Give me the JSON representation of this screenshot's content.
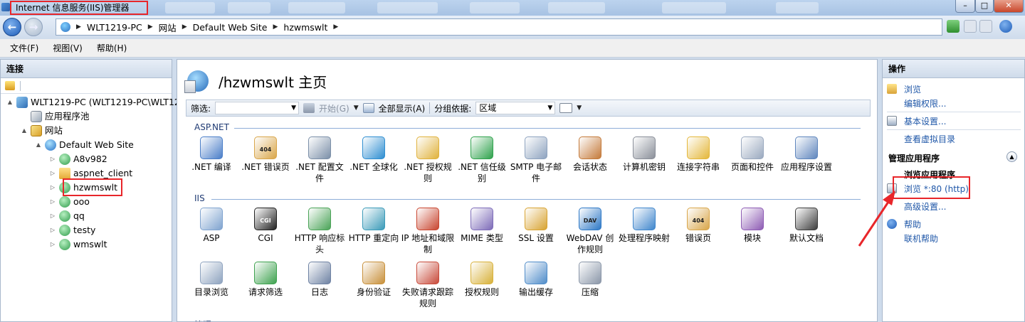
{
  "window": {
    "title": "Internet 信息服务(IIS)管理器",
    "minimize": "–",
    "maximize": "□",
    "close": "✕"
  },
  "nav": {
    "breadcrumb": [
      "WLT1219-PC",
      "网站",
      "Default Web Site",
      "hzwmswlt"
    ],
    "back_icon": "back-arrow-icon",
    "forward_icon": "forward-arrow-icon",
    "back_glyph": "←",
    "forward_glyph": "→",
    "sep_glyph": "▶"
  },
  "menu": [
    "文件(F)",
    "视图(V)",
    "帮助(H)"
  ],
  "connections": {
    "header": "连接",
    "tree": [
      {
        "label": "WLT1219-PC (WLT1219-PC\\WLT12",
        "level": 0,
        "icon": "server-icon",
        "toggle": "▲"
      },
      {
        "label": "应用程序池",
        "level": 1,
        "icon": "app-pool-icon",
        "toggle": ""
      },
      {
        "label": "网站",
        "level": 1,
        "icon": "sites-folder-icon",
        "toggle": "▲"
      },
      {
        "label": "Default Web Site",
        "level": 2,
        "icon": "website-icon",
        "toggle": "▲"
      },
      {
        "label": "A8v982",
        "level": 3,
        "icon": "application-icon",
        "toggle": "▷"
      },
      {
        "label": "aspnet_client",
        "level": 3,
        "icon": "folder-icon",
        "toggle": "▷"
      },
      {
        "label": "hzwmswlt",
        "level": 3,
        "icon": "application-icon",
        "toggle": "▷"
      },
      {
        "label": "ooo",
        "level": 3,
        "icon": "application-icon",
        "toggle": "▷"
      },
      {
        "label": "qq",
        "level": 3,
        "icon": "application-icon",
        "toggle": "▷"
      },
      {
        "label": "testy",
        "level": 3,
        "icon": "application-icon",
        "toggle": "▷"
      },
      {
        "label": "wmswlt",
        "level": 3,
        "icon": "application-icon",
        "toggle": "▷"
      }
    ]
  },
  "main": {
    "title": "/hzwmswlt 主页",
    "filter_label": "筛选:",
    "start_label": "开始(G)",
    "show_all_label": "全部显示(A)",
    "group_by_label": "分组依据:",
    "group_by_value": "区域",
    "dropdown_glyph": "▼",
    "groups": [
      {
        "name": "ASP.NET",
        "features": [
          {
            "label": ".NET 编译",
            "icon": "net-compilation-icon",
            "color": "#4a7ec8"
          },
          {
            "label": ".NET 错误页",
            "icon": "net-error-pages-icon",
            "color": "#d9a64a",
            "badge": "404"
          },
          {
            "label": ".NET 配置文件",
            "icon": "net-profile-icon",
            "color": "#7b8fa8"
          },
          {
            "label": ".NET 全球化",
            "icon": "net-globalization-icon",
            "color": "#2e8ed1"
          },
          {
            "label": ".NET 授权规则",
            "icon": "net-authorization-icon",
            "color": "#e0b23c"
          },
          {
            "label": ".NET 信任级别",
            "icon": "net-trust-icon",
            "color": "#2fa24c"
          },
          {
            "label": "SMTP 电子邮件",
            "icon": "smtp-email-icon",
            "color": "#8ea3bf"
          },
          {
            "label": "会话状态",
            "icon": "session-state-icon",
            "color": "#c47a3a"
          },
          {
            "label": "计算机密钥",
            "icon": "machine-key-icon",
            "color": "#8a8f99"
          },
          {
            "label": "连接字符串",
            "icon": "connection-strings-icon",
            "color": "#e4b73a"
          },
          {
            "label": "页面和控件",
            "icon": "pages-controls-icon",
            "color": "#9aa9bf"
          },
          {
            "label": "应用程序设置",
            "icon": "app-settings-icon",
            "color": "#5f86bd"
          }
        ]
      },
      {
        "name": "IIS",
        "features": [
          {
            "label": "ASP",
            "icon": "asp-icon",
            "color": "#7fa3cf"
          },
          {
            "label": "CGI",
            "icon": "cgi-icon",
            "color": "#222222",
            "badge": "CGI"
          },
          {
            "label": "HTTP 响应标头",
            "icon": "http-headers-icon",
            "color": "#4aa357"
          },
          {
            "label": "HTTP 重定向",
            "icon": "http-redirect-icon",
            "color": "#3a9ab8"
          },
          {
            "label": "IP 地址和域限制",
            "icon": "ip-restrictions-icon",
            "color": "#c8452f"
          },
          {
            "label": "MIME 类型",
            "icon": "mime-types-icon",
            "color": "#7d6bb8"
          },
          {
            "label": "SSL 设置",
            "icon": "ssl-settings-icon",
            "color": "#d8a331"
          },
          {
            "label": "WebDAV 创作规则",
            "icon": "webdav-icon",
            "color": "#2d78c6",
            "badge": "DAV"
          },
          {
            "label": "处理程序映射",
            "icon": "handler-mappings-icon",
            "color": "#3f86cc"
          },
          {
            "label": "错误页",
            "icon": "error-pages-icon",
            "color": "#d9a64a",
            "badge": "404"
          },
          {
            "label": "模块",
            "icon": "modules-icon",
            "color": "#8d5bb3"
          },
          {
            "label": "默认文档",
            "icon": "default-document-icon",
            "color": "#3d3d3d"
          }
        ]
      },
      {
        "name": "",
        "features": [
          {
            "label": "目录浏览",
            "icon": "directory-browsing-icon",
            "color": "#8ea3bf"
          },
          {
            "label": "请求筛选",
            "icon": "request-filtering-icon",
            "color": "#3ea24f"
          },
          {
            "label": "日志",
            "icon": "logging-icon",
            "color": "#6e82a3"
          },
          {
            "label": "身份验证",
            "icon": "authentication-icon",
            "color": "#c8903a"
          },
          {
            "label": "失败请求跟踪规则",
            "icon": "failed-request-tracing-icon",
            "color": "#c84a3a"
          },
          {
            "label": "授权规则",
            "icon": "authorization-rules-icon",
            "color": "#d8b13a"
          },
          {
            "label": "输出缓存",
            "icon": "output-caching-icon",
            "color": "#4f8cc9"
          },
          {
            "label": "压缩",
            "icon": "compression-icon",
            "color": "#8a96a8"
          }
        ]
      }
    ],
    "cut_group": "管理"
  },
  "actions": {
    "header": "操作",
    "items": [
      {
        "label": "浏览",
        "icon": "explore-icon"
      },
      {
        "label": "编辑权限...",
        "icon": ""
      },
      {
        "label": "基本设置...",
        "icon": "basic-settings-icon"
      },
      {
        "label": "查看虚拟目录",
        "icon": ""
      }
    ],
    "manage_app_title": "管理应用程序",
    "collapse_glyph": "▲",
    "browse_app_title": "浏览应用程序",
    "browse_http": "浏览 *:80 (http)",
    "advanced_settings": "高级设置...",
    "help": "帮助",
    "online_help": "联机帮助"
  }
}
